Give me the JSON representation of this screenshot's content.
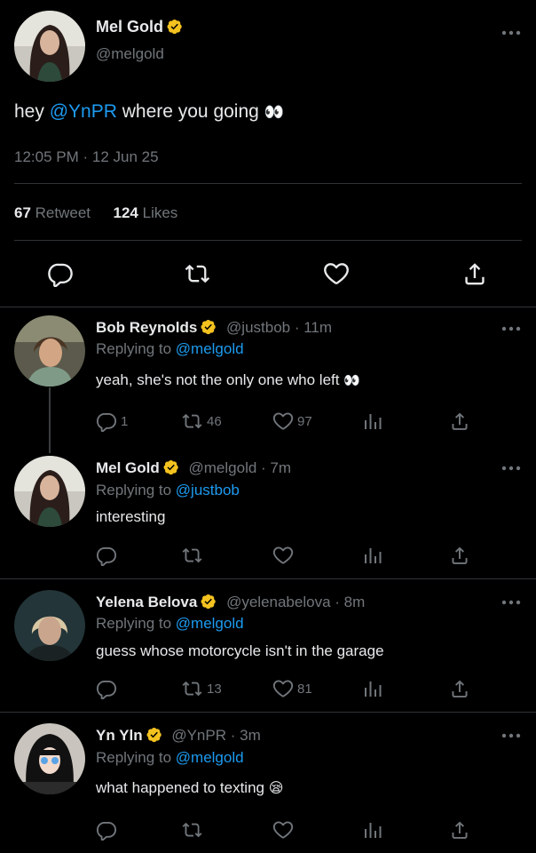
{
  "main_tweet": {
    "name": "Mel Gold",
    "handle": "@melgold",
    "text_before": "hey ",
    "mention": "@YnPR",
    "text_after": " where you going",
    "emoji": "👀",
    "timestamp": "12:05 PM · 12 Jun 25",
    "retweets_count": "67",
    "retweets_label": "Retweet",
    "likes_count": "124",
    "likes_label": "Likes"
  },
  "replies": [
    {
      "name": "Bob Reynolds",
      "handle": "@justbob",
      "time": "· 11m",
      "replying_prefix": "Replying to ",
      "replying_to": "@melgold",
      "text": "yeah, she's not the only one who left",
      "emoji": "👀",
      "reply_count": "1",
      "retweet_count": "46",
      "like_count": "97"
    },
    {
      "name": "Mel Gold",
      "handle": "@melgold",
      "time": "· 7m",
      "replying_prefix": "Replying to ",
      "replying_to": "@justbob",
      "text": "interesting",
      "reply_count": "",
      "retweet_count": "",
      "like_count": ""
    },
    {
      "name": "Yelena Belova",
      "handle": "@yelenabelova",
      "time": "· 8m",
      "replying_prefix": "Replying to ",
      "replying_to": "@melgold",
      "text": "guess whose motorcycle isn't in the garage",
      "reply_count": "",
      "retweet_count": "13",
      "like_count": "81"
    },
    {
      "name": "Yn Yln",
      "handle": "@YnPR",
      "time": "· 3m",
      "replying_prefix": "Replying to ",
      "replying_to": "@melgold",
      "text": "what happened to texting",
      "emoji": "😪",
      "reply_count": "",
      "retweet_count": "",
      "like_count": ""
    }
  ],
  "colors": {
    "background": "#000000",
    "text": "#e7e9ea",
    "muted": "#71767b",
    "link": "#1d9bf0",
    "verified": "#f4c21f",
    "divider": "#2f3336"
  },
  "icons": [
    "verified-badge-icon",
    "more-icon",
    "reply-icon",
    "retweet-icon",
    "like-icon",
    "share-icon",
    "analytics-icon"
  ]
}
